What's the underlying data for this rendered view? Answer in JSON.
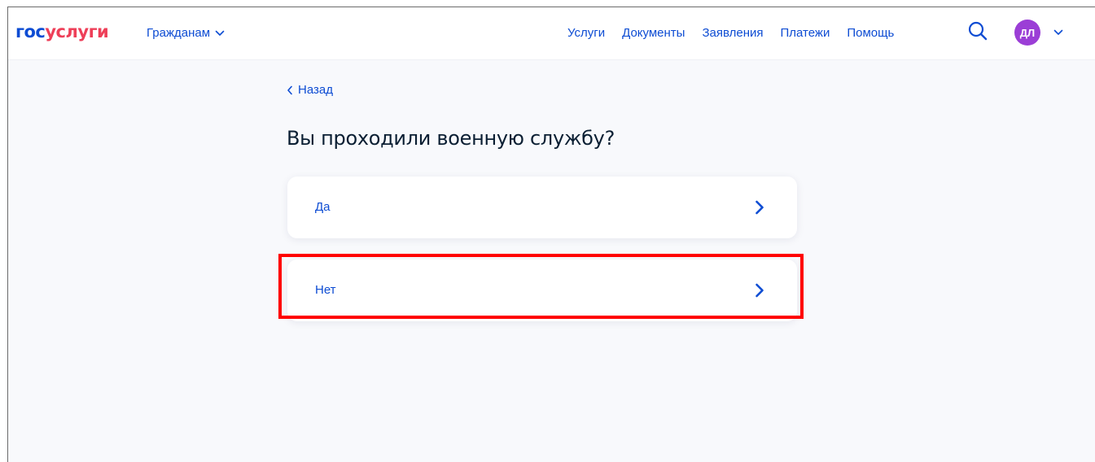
{
  "header": {
    "logo_part1": "гос",
    "logo_part2": "услуги",
    "citizens_menu": "Гражданам",
    "nav": [
      "Услуги",
      "Документы",
      "Заявления",
      "Платежи",
      "Помощь"
    ],
    "avatar_initials": "ДЛ"
  },
  "main": {
    "back_label": "Назад",
    "title": "Вы проходили военную службу?",
    "options": [
      {
        "label": "Да"
      },
      {
        "label": "Нет"
      }
    ]
  },
  "colors": {
    "accent": "#0d4cd3",
    "logo_red": "#ee3f58",
    "avatar_bg": "#9b3ed6",
    "highlight": "#ff0000",
    "page_bg": "#f8f9fc"
  },
  "icons": [
    "chevron-down-icon",
    "search-icon",
    "chevron-left-icon",
    "chevron-right-icon"
  ]
}
